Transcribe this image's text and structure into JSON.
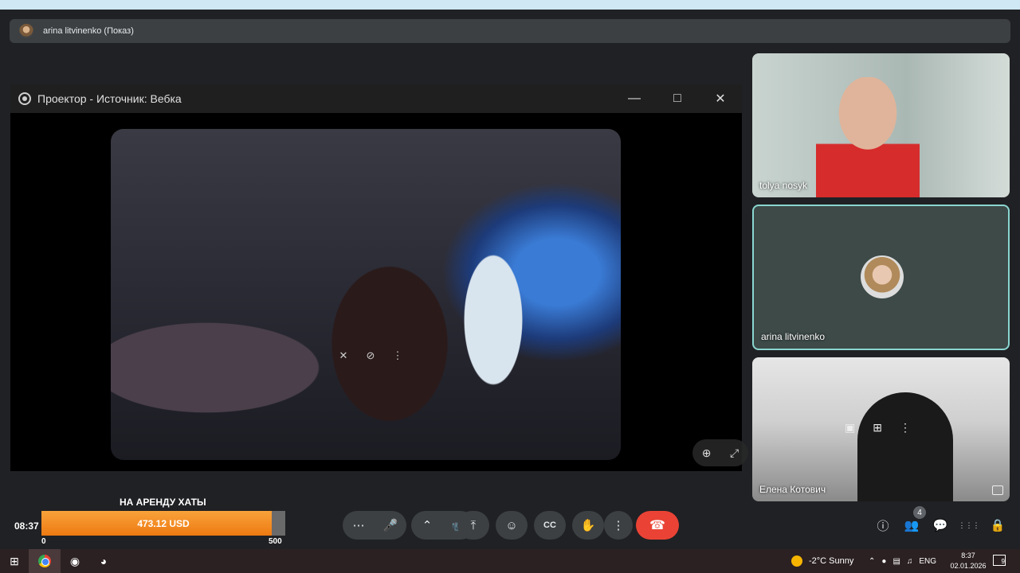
{
  "presenter": {
    "label": "arina litvinenko (Показ)"
  },
  "projector": {
    "title": "Проектор - Источник: Вебка",
    "minimize_icon": "minimize-icon",
    "maximize_icon": "maximize-icon",
    "close_icon": "close-icon"
  },
  "participants": [
    {
      "name": "tolya nosyk"
    },
    {
      "name": "arina litvinenko"
    },
    {
      "name": "Елена Котович"
    }
  ],
  "donation": {
    "title": "НА АРЕНДУ ХАТЫ",
    "time_left": "08:37",
    "amount": "473.12 USD",
    "min": "0",
    "max": "500",
    "progress_fraction": 0.946
  },
  "meeting_controls": {
    "more_options": "⋯",
    "mic": "🎤",
    "chevron": "⌃",
    "camera": "📹",
    "present": "⤒",
    "emoji": "☺",
    "captions": "CC",
    "raise_hand": "✋",
    "kebab": "⋮",
    "end_call": "☎"
  },
  "right_panel": {
    "info": "ⓘ",
    "people": "👥",
    "people_badge": "4",
    "chat": "💬",
    "activities": "⋮⋮⋮",
    "host_controls": "🔒"
  },
  "taskbar": {
    "weather_text": "-2°C  Sunny",
    "language": "ENG",
    "time": "8:37",
    "date": "02.01.2026",
    "notification_count": "9"
  },
  "colors": {
    "end_call": "#ea4335",
    "progress": "#ee7a12",
    "active_tile_border": "#8ad6d0"
  }
}
